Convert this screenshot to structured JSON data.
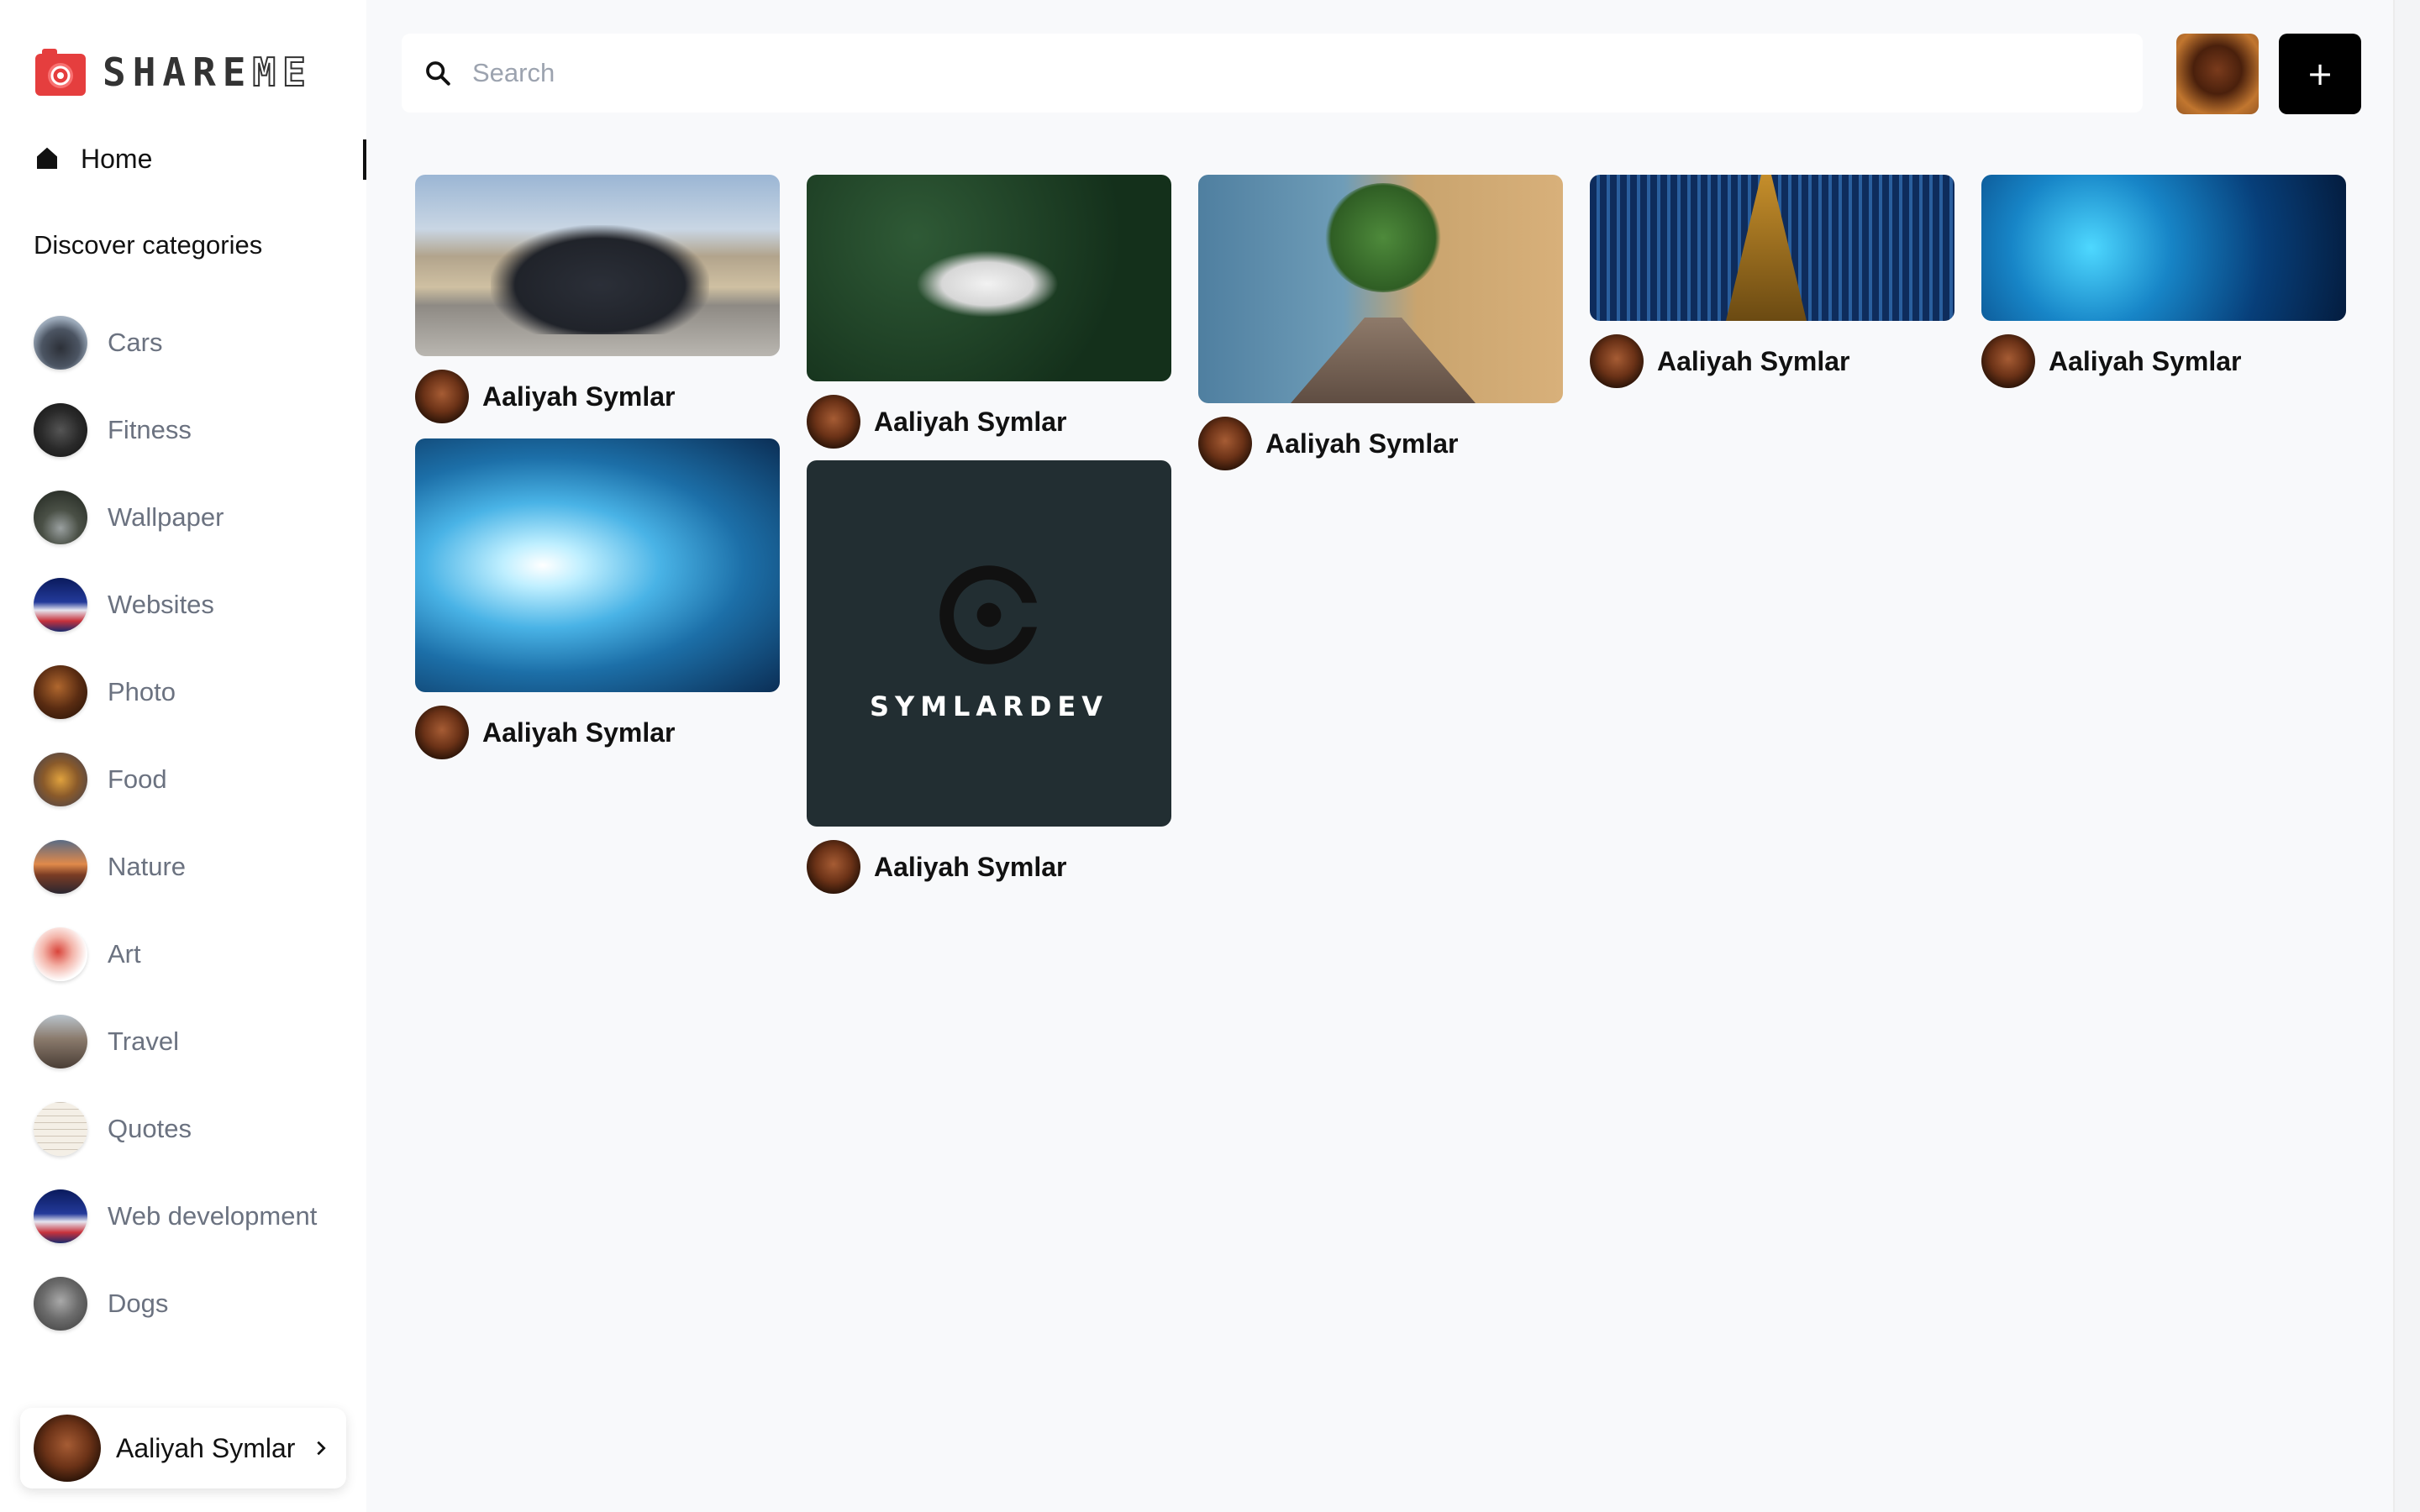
{
  "app": {
    "logo_text_part1": "SHARE",
    "logo_text_part2": "ME"
  },
  "sidebar": {
    "home_label": "Home",
    "discover_title": "Discover categories",
    "categories": [
      {
        "label": "Cars",
        "icon": "cars-thumbnail"
      },
      {
        "label": "Fitness",
        "icon": "fitness-thumbnail"
      },
      {
        "label": "Wallpaper",
        "icon": "wallpaper-thumbnail"
      },
      {
        "label": "Websites",
        "icon": "websites-thumbnail"
      },
      {
        "label": "Photo",
        "icon": "photo-thumbnail"
      },
      {
        "label": "Food",
        "icon": "food-thumbnail"
      },
      {
        "label": "Nature",
        "icon": "nature-thumbnail"
      },
      {
        "label": "Art",
        "icon": "art-thumbnail"
      },
      {
        "label": "Travel",
        "icon": "travel-thumbnail"
      },
      {
        "label": "Quotes",
        "icon": "quotes-thumbnail"
      },
      {
        "label": "Web development",
        "icon": "web-development-thumbnail"
      },
      {
        "label": "Dogs",
        "icon": "dogs-thumbnail"
      }
    ],
    "profile_name": "Aaliyah Symlar"
  },
  "header": {
    "search_placeholder": "Search",
    "search_value": "",
    "add_button_label": "+"
  },
  "pins": [
    {
      "image": "car",
      "author": "Aaliyah Symlar"
    },
    {
      "image": "tunnel",
      "author": "Aaliyah Symlar"
    },
    {
      "image": "drone",
      "author": "Aaliyah Symlar"
    },
    {
      "image": "symlardev-logo",
      "author": "Aaliyah Symlar",
      "image_text": "SYMLARDEV"
    },
    {
      "image": "pier",
      "author": "Aaliyah Symlar"
    },
    {
      "image": "binary-road",
      "author": "Aaliyah Symlar"
    },
    {
      "image": "ai-face",
      "author": "Aaliyah Symlar"
    }
  ],
  "colors": {
    "brand_red": "#e53e3e",
    "accent_black": "#000000",
    "muted_text": "#6b7280",
    "background": "#f8f9fb"
  }
}
